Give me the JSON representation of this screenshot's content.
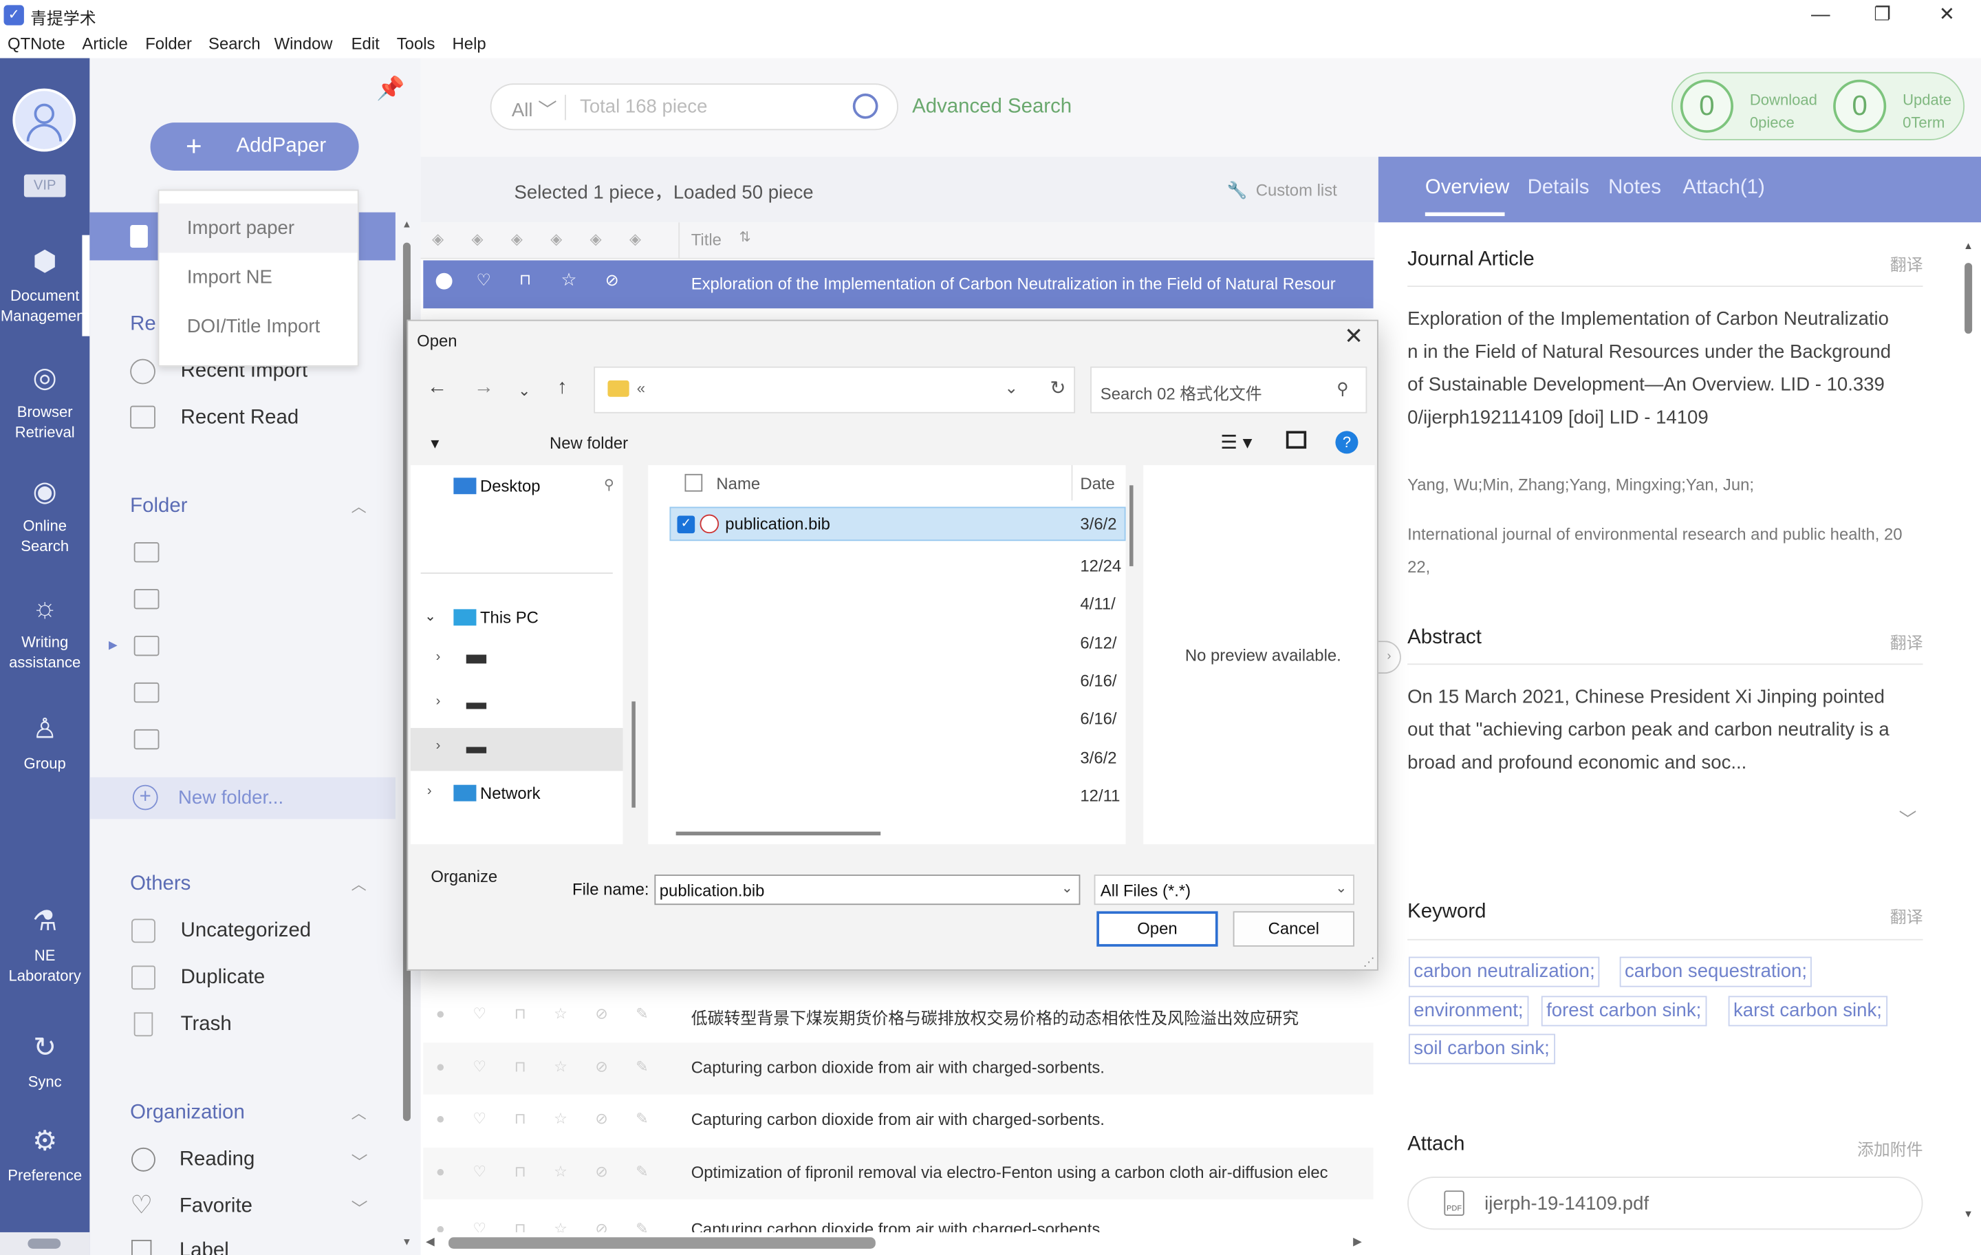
{
  "app": {
    "title": "青提学术",
    "menu": [
      "QTNote",
      "Article",
      "Folder",
      "Search",
      "Window",
      "Edit",
      "Tools",
      "Help"
    ]
  },
  "nav": {
    "vip": "VIP",
    "items": [
      {
        "label1": "Document",
        "label2": "Management"
      },
      {
        "label1": "Browser",
        "label2": "Retrieval"
      },
      {
        "label1": "Online",
        "label2": "Search"
      },
      {
        "label1": "Writing",
        "label2": "assistance"
      },
      {
        "label1": "Group",
        "label2": ""
      },
      {
        "label1": "NE",
        "label2": "Laboratory"
      },
      {
        "label1": "Sync",
        "label2": ""
      },
      {
        "label1": "Preference",
        "label2": ""
      }
    ]
  },
  "sidebar": {
    "add_paper": "AddPaper",
    "dropdown": [
      "Import paper",
      "Import NE",
      "DOI/Title Import"
    ],
    "recent_title": "Re",
    "recent_import": "Recent Import",
    "recent_read": "Recent Read",
    "folder_title": "Folder",
    "new_folder": "New folder...",
    "others_title": "Others",
    "uncategorized": "Uncategorized",
    "duplicate": "Duplicate",
    "trash": "Trash",
    "organization_title": "Organization",
    "reading": "Reading",
    "favorite": "Favorite",
    "label": "Label"
  },
  "search": {
    "scope": "All",
    "placeholder": "Total 168 piece",
    "advanced": "Advanced Search"
  },
  "counters": {
    "download_value": "0",
    "download_label": "Download",
    "download_sub": "0piece",
    "update_value": "0",
    "update_label": "Update",
    "update_sub": "0Term"
  },
  "list": {
    "status": "Selected 1 piece，Loaded 50 piece",
    "custom_list": "Custom list",
    "title_col": "Title",
    "selected_title": "Exploration of the Implementation of Carbon Neutralization in the Field of Natural Resour",
    "rows": [
      "低碳转型背景下煤炭期货价格与碳排放权交易价格的动态相依性及风险溢出效应研究",
      "Capturing carbon dioxide from air with charged-sorbents.",
      "Capturing carbon dioxide from air with charged-sorbents.",
      "Optimization of fipronil removal via electro-Fenton using a carbon cloth air-diffusion elec",
      "Capturing carbon dioxide from air with charged-sorbents."
    ]
  },
  "detail": {
    "tabs": [
      "Overview",
      "Details",
      "Notes",
      "Attach(1)"
    ],
    "type": "Journal Article",
    "translate": "翻译",
    "title_lines": [
      "Exploration of the Implementation of Carbon Neutralizatio",
      "n in the Field of Natural Resources under the Background",
      "of Sustainable Development—An Overview. LID - 10.339",
      "0/ijerph192114109 [doi] LID - 14109"
    ],
    "authors": "Yang, Wu;Min, Zhang;Yang, Mingxing;Yan, Jun;",
    "journal_line1": "International journal of environmental research and public health, 20",
    "journal_line2": "22,",
    "abstract_title": "Abstract",
    "abstract_lines": [
      "On 15 March 2021, Chinese President Xi Jinping pointed",
      "out that \"achieving carbon peak and carbon neutrality is a",
      "broad and profound economic and soc..."
    ],
    "keyword_title": "Keyword",
    "keywords": [
      "carbon neutralization;",
      "carbon sequestration;",
      "environment;",
      "forest carbon sink;",
      "karst carbon sink;",
      "soil carbon sink;"
    ],
    "attach_title": "Attach",
    "attach_add": "添加附件",
    "attach_file": "ijerph-19-14109.pdf"
  },
  "dialog": {
    "title": "Open",
    "address": "«",
    "search_placeholder": "Search 02 格式化文件",
    "organize": "Organize",
    "new_folder": "New folder",
    "nav": {
      "desktop": "Desktop",
      "this_pc": "This PC",
      "network": "Network"
    },
    "col_name": "Name",
    "col_date": "Date",
    "files": [
      {
        "name": "publication.bib",
        "date": "3/6/2"
      }
    ],
    "dates": [
      "12/24",
      "4/11/",
      "6/12/",
      "6/16/",
      "6/16/",
      "3/6/2",
      "12/11"
    ],
    "no_preview": "No preview available.",
    "file_name_label": "File name:",
    "file_name_value": "publication.bib",
    "file_type": "All Files (*.*)",
    "open": "Open",
    "cancel": "Cancel"
  }
}
